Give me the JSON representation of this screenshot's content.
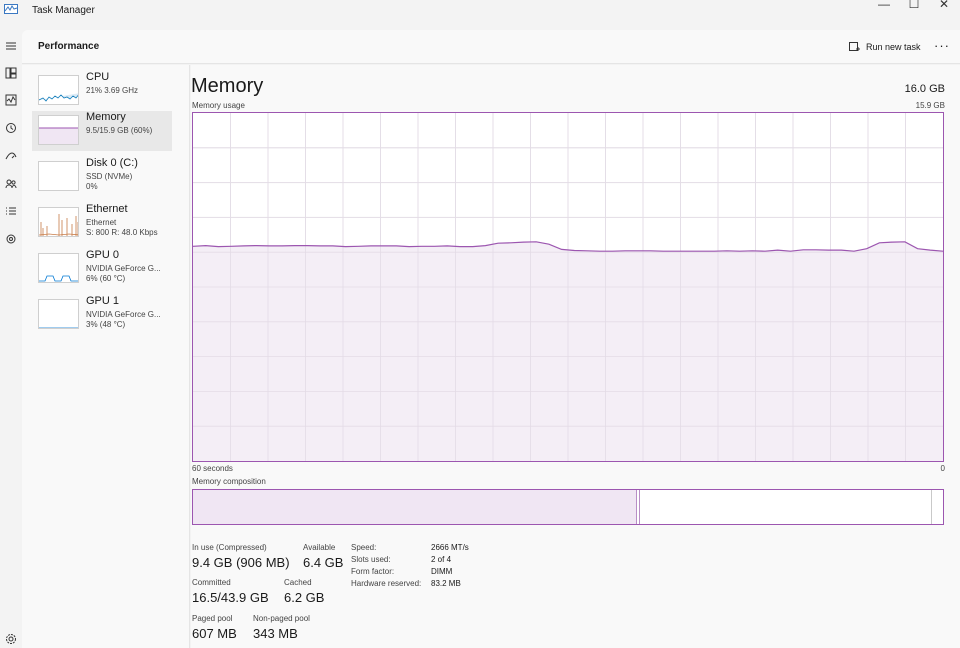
{
  "window": {
    "title": "Task Manager",
    "controls": [
      "—",
      "☐",
      "✕"
    ]
  },
  "header": {
    "page_title": "Performance",
    "run_task_label": "Run new task",
    "more_label": "···"
  },
  "colors": {
    "memory_accent": "#9c56b0",
    "cpu_accent": "#117dbb",
    "ethernet_accent": "#c77c48",
    "gpu_accent": "#0078d4"
  },
  "rail_icons": [
    "hamburger-icon",
    "processes-icon",
    "performance-icon",
    "app-history-icon",
    "startup-apps-icon",
    "users-icon",
    "details-icon",
    "services-icon",
    "settings-icon"
  ],
  "devices": [
    {
      "name": "CPU",
      "line1": "21%  3.69 GHz",
      "line2": ""
    },
    {
      "name": "Memory",
      "line1": "9.5/15.9 GB (60%)",
      "line2": ""
    },
    {
      "name": "Disk 0 (C:)",
      "line1": "SSD (NVMe)",
      "line2": "0%"
    },
    {
      "name": "Ethernet",
      "line1": "Ethernet",
      "line2": "S: 800  R: 48.0 Kbps"
    },
    {
      "name": "GPU 0",
      "line1": "NVIDIA GeForce G...",
      "line2": "6%  (60 °C)"
    },
    {
      "name": "GPU 1",
      "line1": "NVIDIA GeForce G...",
      "line2": "3%  (48 °C)"
    }
  ],
  "memory": {
    "title": "Memory",
    "total": "16.0 GB",
    "usage_label": "Memory usage",
    "usage_max": "15.9 GB",
    "time_left": "60 seconds",
    "time_right": "0",
    "composition_label": "Memory composition",
    "usage_series_percent": [
      61.7,
      61.9,
      61.6,
      61.7,
      61.8,
      61.9,
      61.8,
      61.8,
      61.9,
      61.9,
      61.8,
      61.8,
      61.6,
      61.7,
      61.8,
      61.8,
      61.8,
      61.6,
      61.7,
      61.7,
      61.8,
      61.6,
      61.6,
      61.9,
      62.6,
      62.7,
      62.9,
      63.0,
      62.3,
      60.8,
      60.5,
      60.4,
      60.3,
      60.3,
      60.4,
      60.4,
      60.4,
      60.3,
      60.3,
      60.3,
      60.3,
      60.3,
      60.4,
      60.3,
      60.4,
      60.3,
      60.6,
      60.3,
      60.7,
      60.7,
      60.6,
      60.6,
      60.3,
      61.0,
      62.7,
      62.9,
      63.0,
      61.0,
      60.6,
      60.3
    ],
    "composition": {
      "in_use_pct": 59.2,
      "modified_pct": 0.4,
      "standby_pct": 38.9
    },
    "stats": {
      "in_use_label": "In use (Compressed)",
      "in_use_value": "9.4 GB (906 MB)",
      "available_label": "Available",
      "available_value": "6.4 GB",
      "committed_label": "Committed",
      "committed_value": "16.5/43.9 GB",
      "cached_label": "Cached",
      "cached_value": "6.2 GB",
      "paged_label": "Paged pool",
      "paged_value": "607 MB",
      "nonpaged_label": "Non-paged pool",
      "nonpaged_value": "343 MB"
    },
    "details": [
      {
        "label": "Speed:",
        "value": "2666 MT/s"
      },
      {
        "label": "Slots used:",
        "value": "2 of 4"
      },
      {
        "label": "Form factor:",
        "value": "DIMM"
      },
      {
        "label": "Hardware reserved:",
        "value": "83.2 MB"
      }
    ]
  }
}
